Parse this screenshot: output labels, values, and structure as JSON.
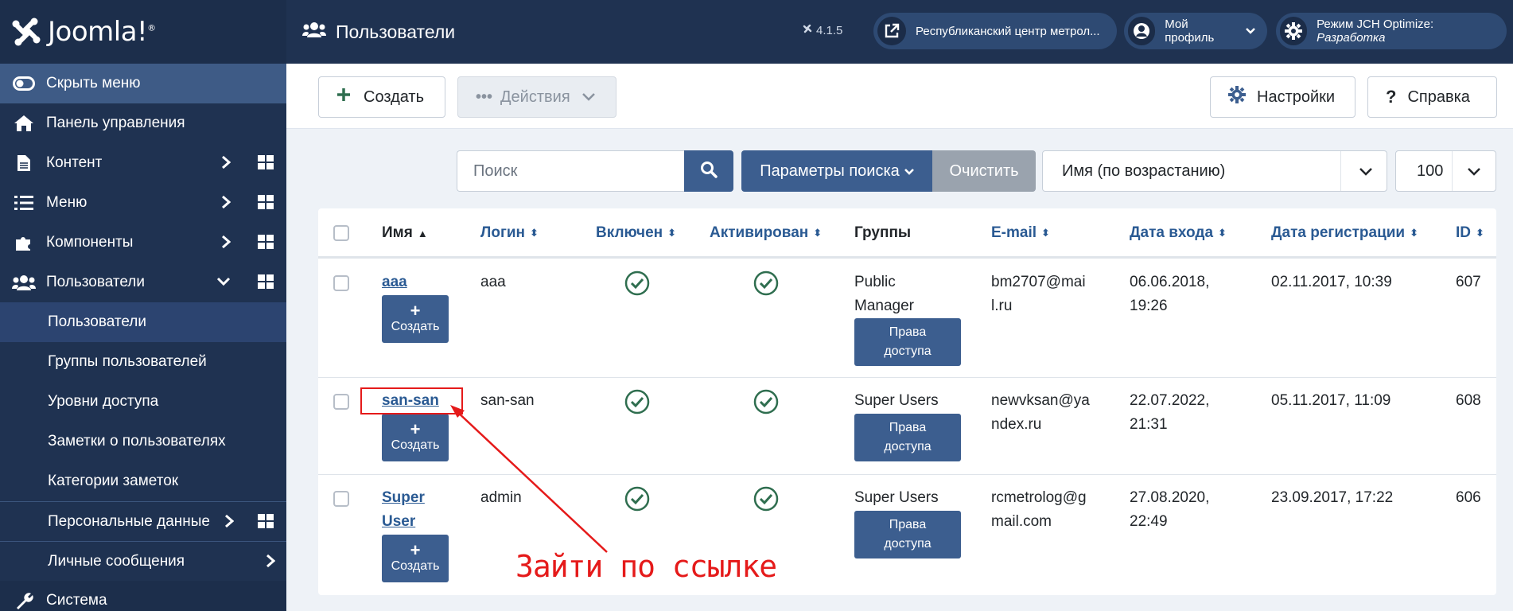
{
  "app": {
    "logo_text": "Joomla!",
    "logo_reg": "®",
    "version": "4.1.5"
  },
  "sidebar": {
    "hide_menu": "Скрыть меню",
    "items": [
      {
        "label": "Панель управления",
        "icon": "home-icon"
      },
      {
        "label": "Контент",
        "icon": "file-icon"
      },
      {
        "label": "Меню",
        "icon": "list-icon"
      },
      {
        "label": "Компоненты",
        "icon": "puzzle-icon"
      },
      {
        "label": "Пользователи",
        "icon": "users-icon"
      }
    ],
    "sub_items": [
      "Пользователи",
      "Группы пользователей",
      "Уровни доступа",
      "Заметки о пользователях",
      "Категории заметок",
      "Персональные данные",
      "Личные сообщения"
    ],
    "system": "Система"
  },
  "header": {
    "title": "Пользователи",
    "site_name": "Республиканский центр метрол...",
    "profile": "Мой профиль",
    "jch_prefix": "Режим JCH Optimize: ",
    "jch_mode": "Разработка"
  },
  "toolbar": {
    "create": "Создать",
    "actions": "Действия",
    "options": "Настройки",
    "help": "Справка"
  },
  "filters": {
    "search_placeholder": "Поиск",
    "search_options": "Параметры поиска",
    "clear": "Очистить",
    "ordering": "Имя (по возрастанию)",
    "limit": "100"
  },
  "table": {
    "columns": [
      "Имя",
      "Логин",
      "Включен",
      "Активирован",
      "Группы",
      "E-mail",
      "Дата входа",
      "Дата регистрации",
      "ID"
    ],
    "create_note": "Создать",
    "access_line1": "Права",
    "access_line2": "доступа",
    "rows": [
      {
        "name": "aaa",
        "login": "aaa",
        "groups": [
          "Public",
          "Manager"
        ],
        "email": [
          "bm2707@mai",
          "l.ru"
        ],
        "last_visit": [
          "06.06.2018,",
          "19:26"
        ],
        "registered": "02.11.2017, 10:39",
        "id": "607"
      },
      {
        "name": "san-san",
        "login": "san-san",
        "groups": [
          "Super Users"
        ],
        "email": [
          "newvksan@ya",
          "ndex.ru"
        ],
        "last_visit": [
          "22.07.2022,",
          "21:31"
        ],
        "registered": "05.11.2017, 11:09",
        "id": "608"
      },
      {
        "name_lines": [
          "Super",
          "User"
        ],
        "login": "admin",
        "groups": [
          "Super Users"
        ],
        "email": [
          "rcmetrolog@g",
          "mail.com"
        ],
        "last_visit": [
          "27.08.2020,",
          "22:49"
        ],
        "registered": "23.09.2017, 17:22",
        "id": "606"
      }
    ]
  },
  "annotation": {
    "text": "Зайти по ссылке",
    "color": "#e51a1a"
  },
  "colors": {
    "sidebar_bg": "#1f3251",
    "accent": "#3c5e8f",
    "link": "#2a5a93",
    "check": "#2f6e4f"
  }
}
